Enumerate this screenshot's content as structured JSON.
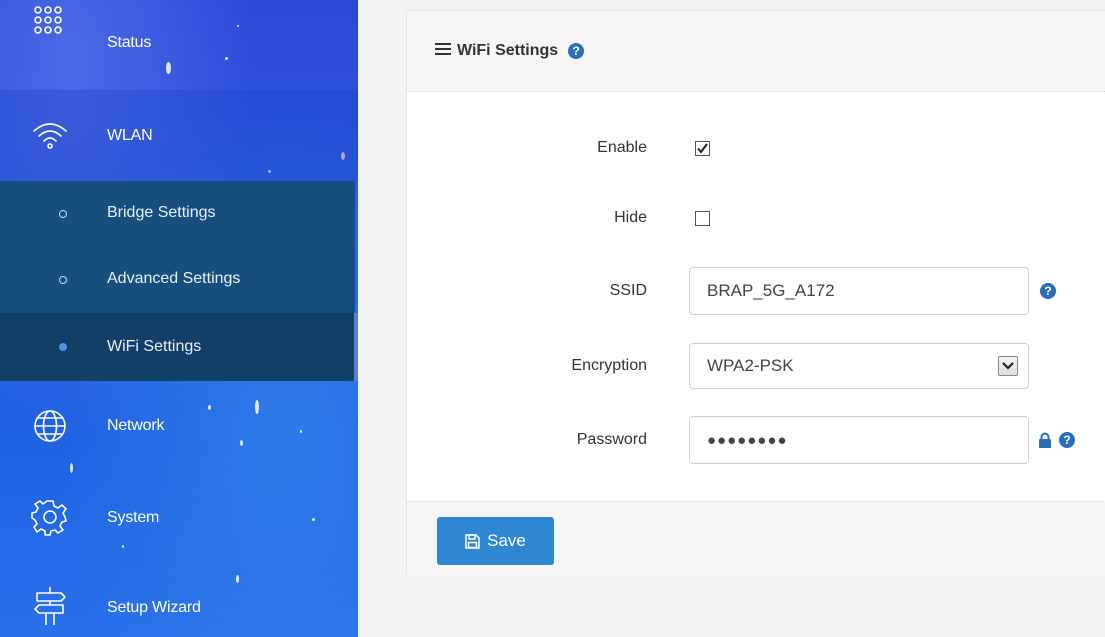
{
  "sidebar": {
    "items": [
      {
        "label": "Status",
        "icon": "grid-dots-icon"
      },
      {
        "label": "WLAN",
        "icon": "wifi-icon"
      },
      {
        "label": "Network",
        "icon": "globe-icon"
      },
      {
        "label": "System",
        "icon": "gear-icon"
      },
      {
        "label": "Setup Wizard",
        "icon": "signpost-icon"
      }
    ],
    "wlan_sub": [
      {
        "label": "Bridge Settings",
        "active": false
      },
      {
        "label": "Advanced Settings",
        "active": false
      },
      {
        "label": "WiFi Settings",
        "active": true
      }
    ]
  },
  "panel": {
    "title": "WiFi Settings",
    "help_glyph": "?",
    "fields": {
      "enable": {
        "label": "Enable",
        "checked": true
      },
      "hide": {
        "label": "Hide",
        "checked": false
      },
      "ssid": {
        "label": "SSID",
        "value": "BRAP_5G_A172"
      },
      "encryption": {
        "label": "Encryption",
        "value": "WPA2-PSK"
      },
      "password": {
        "label": "Password",
        "value": "●●●●●●●●"
      }
    },
    "save_label": "Save"
  },
  "colors": {
    "primary": "#2f86d2",
    "help": "#2a6db8",
    "submenu": "#164e7e",
    "submenu_active": "#123f66"
  }
}
